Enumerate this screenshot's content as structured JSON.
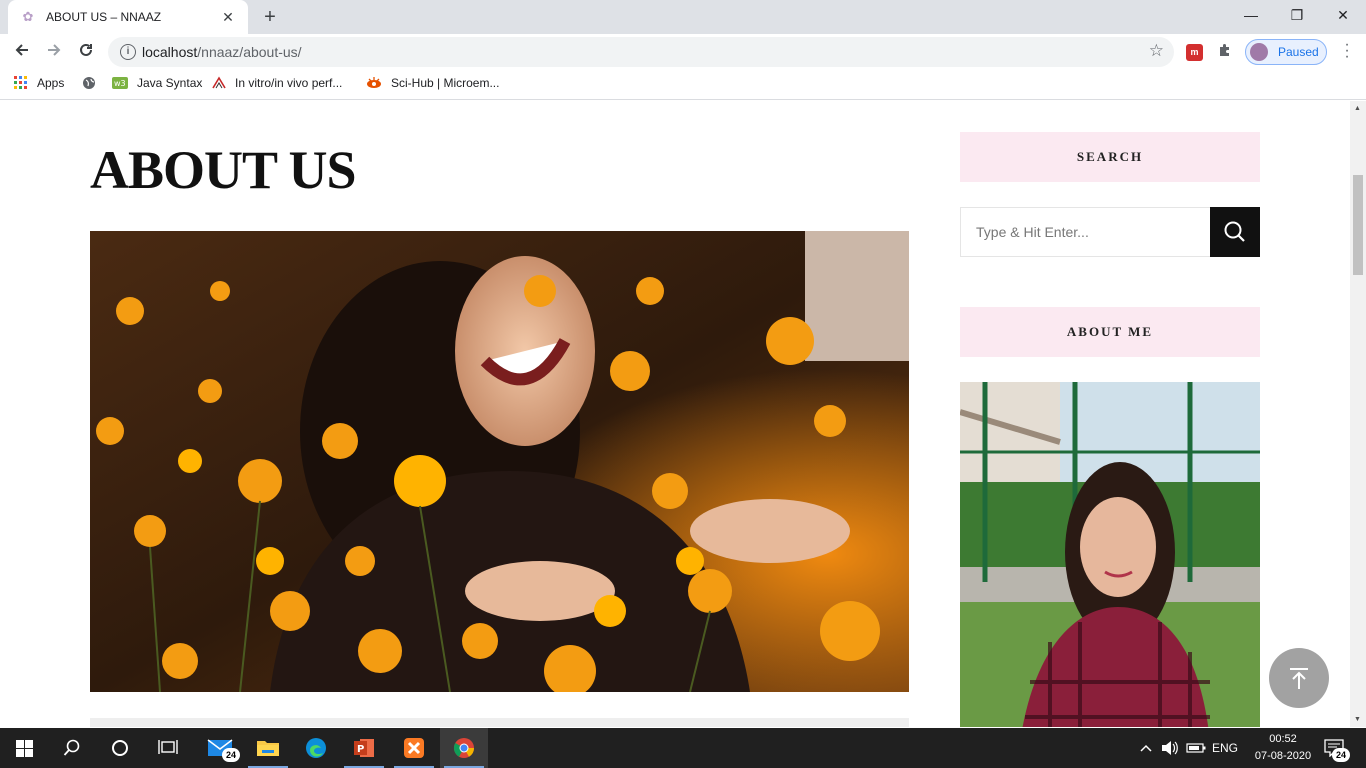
{
  "browser": {
    "tab_title": "ABOUT US – NNAAZ",
    "url_host": "localhost",
    "url_path": "/nnaaz/about-us/",
    "profile_label": "Paused"
  },
  "bookmarks": [
    {
      "label": "Apps"
    },
    {
      "label": ""
    },
    {
      "label": "Java Syntax"
    },
    {
      "label": "In vitro/in vivo perf..."
    },
    {
      "label": "Sci-Hub | Microem..."
    }
  ],
  "page": {
    "title": "ABOUT US"
  },
  "sidebar": {
    "search_title": "SEARCH",
    "search_placeholder": "Type & Hit Enter...",
    "about_title": "ABOUT ME"
  },
  "taskbar": {
    "mail_badge": "24",
    "language": "ENG",
    "time": "00:52",
    "date": "07-08-2020",
    "notification_badge": "24"
  }
}
